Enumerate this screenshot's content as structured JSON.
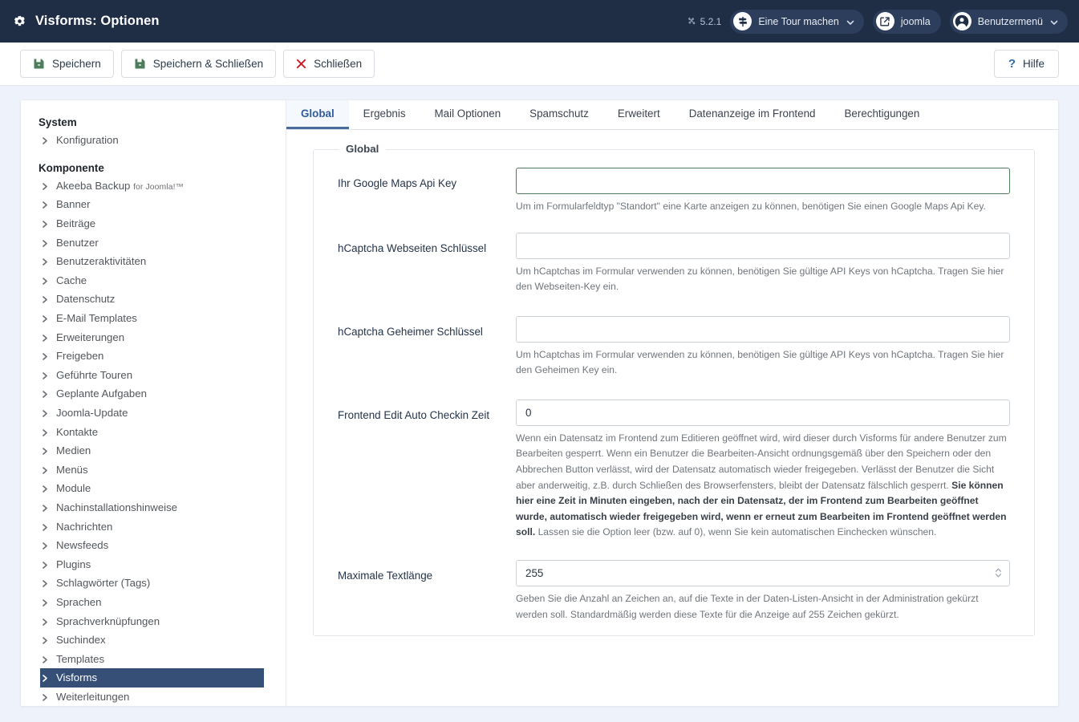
{
  "header": {
    "title": "Visforms: Optionen",
    "gear_icon": "gear-icon",
    "version": "5.2.1",
    "version_icon": "joomla-logo-icon",
    "tour_button": "Eine Tour machen",
    "tour_icon": "signpost-icon",
    "joomla_button": "joomla",
    "joomla_icon": "external-link-icon",
    "user_menu": "Benutzermenü",
    "user_icon": "user-circle-icon",
    "chevron_icon": "chevron-down-icon",
    "bg_color": "#1f2d45"
  },
  "toolbar": {
    "save_label": "Speichern",
    "save_icon": "floppy-disk-icon",
    "save_close_label": "Speichern & Schließen",
    "save_close_icon": "floppy-disk-icon",
    "close_label": "Schließen",
    "close_icon": "close-x-icon",
    "help_label": "Hilfe",
    "help_icon": "question-mark-icon",
    "save_icon_color": "#4d7d5a",
    "close_icon_color": "#c9202a",
    "help_icon_color": "#2f6ba8"
  },
  "sidebar": {
    "groups": [
      {
        "title": "System",
        "items": [
          {
            "label": "Konfiguration",
            "active": false
          }
        ]
      },
      {
        "title": "Komponente",
        "items": [
          {
            "label": "Akeeba Backup",
            "sublabel": "for Joomla!™",
            "active": false
          },
          {
            "label": "Banner",
            "active": false
          },
          {
            "label": "Beiträge",
            "active": false
          },
          {
            "label": "Benutzer",
            "active": false
          },
          {
            "label": "Benutzeraktivitäten",
            "active": false
          },
          {
            "label": "Cache",
            "active": false
          },
          {
            "label": "Datenschutz",
            "active": false
          },
          {
            "label": "E-Mail Templates",
            "active": false
          },
          {
            "label": "Erweiterungen",
            "active": false
          },
          {
            "label": "Freigeben",
            "active": false
          },
          {
            "label": "Geführte Touren",
            "active": false
          },
          {
            "label": "Geplante Aufgaben",
            "active": false
          },
          {
            "label": "Joomla-Update",
            "active": false
          },
          {
            "label": "Kontakte",
            "active": false
          },
          {
            "label": "Medien",
            "active": false
          },
          {
            "label": "Menüs",
            "active": false
          },
          {
            "label": "Module",
            "active": false
          },
          {
            "label": "Nachinstallationshinweise",
            "active": false
          },
          {
            "label": "Nachrichten",
            "active": false
          },
          {
            "label": "Newsfeeds",
            "active": false
          },
          {
            "label": "Plugins",
            "active": false
          },
          {
            "label": "Schlagwörter (Tags)",
            "active": false
          },
          {
            "label": "Sprachen",
            "active": false
          },
          {
            "label": "Sprachverknüpfungen",
            "active": false
          },
          {
            "label": "Suchindex",
            "active": false
          },
          {
            "label": "Templates",
            "active": false
          },
          {
            "label": "Visforms",
            "active": true
          },
          {
            "label": "Weiterleitungen",
            "active": false
          }
        ]
      }
    ],
    "active_bg": "#364f77",
    "caret_icon": "chevron-right-icon"
  },
  "tabs": [
    {
      "label": "Global",
      "active": true
    },
    {
      "label": "Ergebnis",
      "active": false
    },
    {
      "label": "Mail Optionen",
      "active": false
    },
    {
      "label": "Spamschutz",
      "active": false
    },
    {
      "label": "Erweitert",
      "active": false
    },
    {
      "label": "Datenanzeige im Frontend",
      "active": false
    },
    {
      "label": "Berechtigungen",
      "active": false
    }
  ],
  "form": {
    "legend": "Global",
    "fields": [
      {
        "label": "Ihr Google Maps Api Key",
        "value": "",
        "placeholder": "",
        "help": "Um im Formularfeldtyp \"Standort\" eine Karte anzeigen zu können, benötigen Sie einen Google Maps Api Key.",
        "state": "valid"
      },
      {
        "label": "hCaptcha Webseiten Schlüssel",
        "value": "",
        "placeholder": "",
        "help": "Um hCaptchas im Formular verwenden zu können, benötigen Sie gültige API Keys von hCaptcha. Tragen Sie hier den Webseiten-Key ein.",
        "state": "default"
      },
      {
        "label": "hCaptcha Geheimer Schlüssel",
        "value": "",
        "placeholder": "",
        "help": "Um hCaptchas im Formular verwenden zu können, benötigen Sie gültige API Keys von hCaptcha. Tragen Sie hier den Geheimen Key ein.",
        "state": "default"
      },
      {
        "label": "Frontend Edit Auto Checkin Zeit",
        "value": "0",
        "placeholder": "",
        "help_part1": "Wenn ein Datensatz im Frontend zum Editieren geöffnet wird, wird dieser durch Visforms für andere Benutzer zum Bearbeiten gesperrt. Wenn ein Benutzer die Bearbeiten-Ansicht ordnungsgemäß über den Speichern oder den Abbrechen Button verlässt, wird der Datensatz automatisch wieder freigegeben. Verlässt der Benutzer die Sicht aber anderweitig, z.B. durch Schließen des Browserfensters, bleibt der Datensatz fälschlich gesperrt. ",
        "help_bold": "Sie können hier eine Zeit in Minuten eingeben, nach der ein Datensatz, der im Frontend zum Bearbeiten geöffnet wurde, automatisch wieder freigegeben wird, wenn er erneut zum Bearbeiten im Frontend geöffnet werden soll.",
        "help_part2": " Lassen sie die Option leer (bzw. auf 0), wenn Sie kein automatischen Einchecken wünschen.",
        "state": "default"
      },
      {
        "label": "Maximale Textlänge",
        "value": "255",
        "placeholder": "",
        "help": "Geben Sie die Anzahl an Zeichen an, auf die Texte in der Daten-Listen-Ansicht in der Administration gekürzt werden soll. Standardmäßig werden diese Texte für die Anzeige auf 255 Zeichen gekürzt.",
        "state": "default",
        "stepper": true,
        "stepper_icon": "spinner-arrows-icon"
      }
    ]
  }
}
